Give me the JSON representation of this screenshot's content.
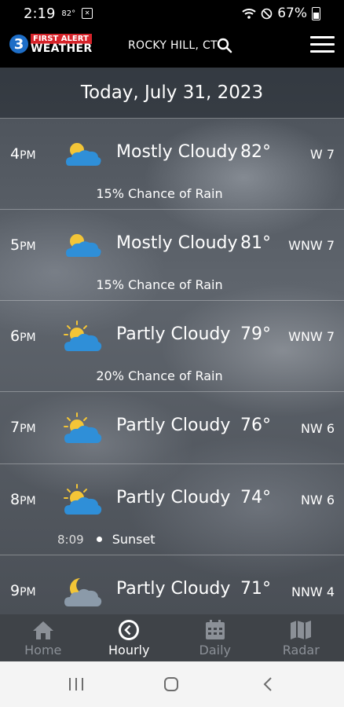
{
  "status": {
    "time": "2:19",
    "temp_mini": "82°",
    "battery": "67%"
  },
  "header": {
    "logo_top": "FIRST ALERT",
    "logo_bottom": "WEATHER",
    "logo_number": "3",
    "location": "ROCKY HILL, CT"
  },
  "date": "Today, July 31, 2023",
  "hours": [
    {
      "hour": "4",
      "ampm": "PM",
      "icon": "partly-cloudy-day-icon",
      "condition": "Mostly Cloudy",
      "temp": "82°",
      "wind": "W 7",
      "rain": "15% Chance of Rain"
    },
    {
      "hour": "5",
      "ampm": "PM",
      "icon": "partly-cloudy-day-icon",
      "condition": "Mostly Cloudy",
      "temp": "81°",
      "wind": "WNW 7",
      "rain": "15% Chance of Rain"
    },
    {
      "hour": "6",
      "ampm": "PM",
      "icon": "partly-sunny-icon",
      "condition": "Partly Cloudy",
      "temp": "79°",
      "wind": "WNW 7",
      "rain": "20% Chance of Rain"
    },
    {
      "hour": "7",
      "ampm": "PM",
      "icon": "partly-sunny-icon",
      "condition": "Partly Cloudy",
      "temp": "76°",
      "wind": "NW 6"
    },
    {
      "hour": "8",
      "ampm": "PM",
      "icon": "partly-sunny-icon",
      "condition": "Partly Cloudy",
      "temp": "74°",
      "wind": "NW 6",
      "sunset_time": "8:09",
      "sunset_label": "Sunset"
    },
    {
      "hour": "9",
      "ampm": "PM",
      "icon": "partly-cloudy-night-icon",
      "condition": "Partly Cloudy",
      "temp": "71°",
      "wind": "NNW 4"
    }
  ],
  "tabs": [
    {
      "label": "Home",
      "icon": "home-icon"
    },
    {
      "label": "Hourly",
      "icon": "clock-icon",
      "active": true
    },
    {
      "label": "Daily",
      "icon": "calendar-icon"
    },
    {
      "label": "Radar",
      "icon": "map-icon"
    }
  ],
  "colors": {
    "cloud": "#2f8fd8",
    "sun": "#f3c537",
    "night_cloud": "#8b9aa9"
  }
}
